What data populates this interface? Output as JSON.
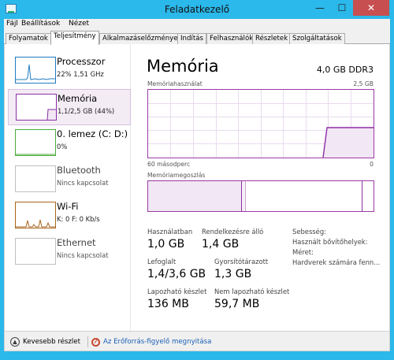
{
  "window": {
    "title": "Feladatkezelő"
  },
  "titlebar_buttons": {
    "minimize": "—",
    "maximize": "☐",
    "close": "✕"
  },
  "menu": [
    "Fájl",
    "Beállítások",
    "Nézet"
  ],
  "tabs": [
    "Folyamatok",
    "Teljesítmény",
    "Alkalmazáselőzmények",
    "Indítás",
    "Felhasználók",
    "Részletek",
    "Szolgáltatások"
  ],
  "active_tab": "Teljesítmény",
  "sidebar": {
    "items": [
      {
        "name": "Processzor",
        "detail": "22%  1,51 GHz",
        "color": "#1f7bc0"
      },
      {
        "name": "Memória",
        "detail": "1,1/2,5 GB (44%)",
        "color": "#8b2fa5"
      },
      {
        "name": "0. lemez (C: D:)",
        "detail": "0%",
        "color": "#4daa3e"
      },
      {
        "name": "Bluetooth",
        "detail": "Nincs kapcsolat",
        "color": "#c0c0c0"
      },
      {
        "name": "Wi-Fi",
        "detail": "K: 0  F: 0 Kb/s",
        "color": "#a8651c"
      },
      {
        "name": "Ethernet",
        "detail": "Nincs kapcsolat",
        "color": "#c0c0c0"
      }
    ]
  },
  "memory": {
    "title": "Memória",
    "total": "4,0 GB DDR3",
    "usage_label": "Memóriahasználat",
    "usage_max": "2,5 GB",
    "time_left": "60 másodperc",
    "time_right": "0",
    "composition_label": "Memóriamegoszlás",
    "stats": [
      {
        "label": "Használatban",
        "value": "1,0 GB"
      },
      {
        "label": "Rendelkezésre álló",
        "value": "1,4 GB"
      },
      {
        "label": "Lefoglalt",
        "value": "1,4/3,6 GB"
      },
      {
        "label": "Gyorsítótárazott",
        "value": "1,3 GB"
      },
      {
        "label": "Lapozható készlet",
        "value": "136 MB"
      },
      {
        "label": "Nem lapozható készlet",
        "value": "59,7 MB"
      }
    ],
    "info": [
      "Sebesség:",
      "Használt bővítőhelyek:",
      "Méret:",
      "Hardverek számára fenn..."
    ]
  },
  "footer": {
    "fewer_details": "Kevesebb részlet",
    "open_monitor": "Az Erőforrás-figyelő megnyitása"
  },
  "colors": {
    "accent_purple": "#8b2fa5",
    "fill_purple": "#f2e7f5",
    "titlebar": "#2bb8ea"
  }
}
